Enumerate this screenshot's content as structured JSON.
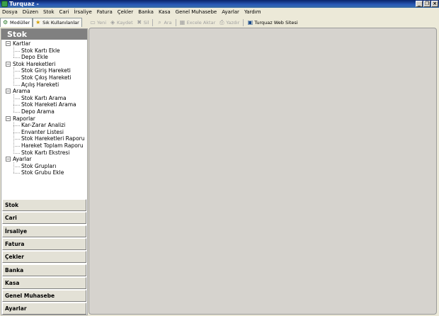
{
  "window": {
    "title": "Turquaz -",
    "minimize": "_",
    "maximize": "❐",
    "close": "×"
  },
  "menu": [
    "Dosya",
    "Düzen",
    "Stok",
    "Cari",
    "İrsaliye",
    "Fatura",
    "Çekler",
    "Banka",
    "Kasa",
    "Genel Muhasebe",
    "Ayarlar",
    "Yardım"
  ],
  "tabs": [
    {
      "label": "Modüller",
      "active": true
    },
    {
      "label": "Sık Kullanılanlar",
      "active": false
    }
  ],
  "toolbar": [
    {
      "label": "Yeni",
      "icon": "new-icon",
      "enabled": false
    },
    {
      "label": "Kaydet",
      "icon": "save-icon",
      "enabled": false
    },
    {
      "label": "Sil",
      "icon": "delete-icon",
      "enabled": false
    },
    {
      "label": "Ara",
      "icon": "search-icon",
      "enabled": false
    },
    {
      "label": "Excele Aktar",
      "icon": "excel-icon",
      "enabled": false
    },
    {
      "label": "Yazdır",
      "icon": "print-icon",
      "enabled": false
    },
    {
      "label": "Turquaz Web Sitesi",
      "icon": "web-icon",
      "enabled": true
    }
  ],
  "panel": {
    "header": "Stok",
    "tree": [
      {
        "label": "Kartlar",
        "children": [
          "Stok Kartı Ekle",
          "Depo Ekle"
        ]
      },
      {
        "label": "Stok Hareketleri",
        "children": [
          "Stok Giriş Hareketi",
          "Stok Çıkış Hareketi",
          "Açılış Hareketi"
        ]
      },
      {
        "label": "Arama",
        "children": [
          "Stok Kartı Arama",
          "Stok Hareketi Arama",
          "Depo Arama"
        ]
      },
      {
        "label": "Raporlar",
        "children": [
          "Kar-Zarar Analizi",
          "Envanter Listesi",
          "Stok Hareketleri Raporu",
          "Hareket Toplam Raporu",
          "Stok Kartı Ekstresi"
        ]
      },
      {
        "label": "Ayarlar",
        "children": [
          "Stok Grupları",
          "Stok Grubu Ekle"
        ]
      }
    ],
    "expander_symbol": "−",
    "modules": [
      "Stok",
      "Cari",
      "İrsaliye",
      "Fatura",
      "Çekler",
      "Banka",
      "Kasa",
      "Genel Muhasebe",
      "Ayarlar"
    ]
  }
}
